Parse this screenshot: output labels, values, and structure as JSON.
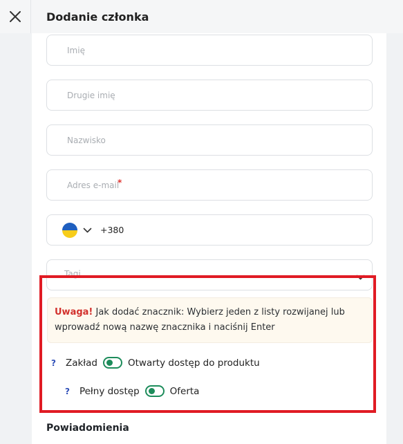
{
  "header": {
    "title": "Dodanie członka",
    "close_icon": "close-icon"
  },
  "form": {
    "first_name_placeholder": "Imię",
    "middle_name_placeholder": "Drugie imię",
    "last_name_placeholder": "Nazwisko",
    "email_placeholder": "Adres e-mail",
    "email_required_mark": "*",
    "phone": {
      "country_flag": "ukraine-flag-icon",
      "dial_code": "+380"
    },
    "tags_placeholder": "Tagi"
  },
  "alert": {
    "label": "Uwaga!",
    "text": "Jak dodać znacznik: Wybierz jeden z listy rozwijanej lub wprowadź nową nazwę znacznika i naciśnij Enter"
  },
  "permissions": {
    "row1": {
      "help": "?",
      "left_label": "Zakład",
      "right_label": "Otwarty dostęp do produktu"
    },
    "row2": {
      "help": "?",
      "left_label": "Pełny dostęp",
      "right_label": "Oferta"
    }
  },
  "notifications": {
    "title": "Powiadomienia"
  },
  "colors": {
    "accent_green": "#1d8c5b",
    "highlight_red": "#e01b24",
    "warning_red": "#d2312d",
    "help_blue": "#2f4fb8"
  }
}
